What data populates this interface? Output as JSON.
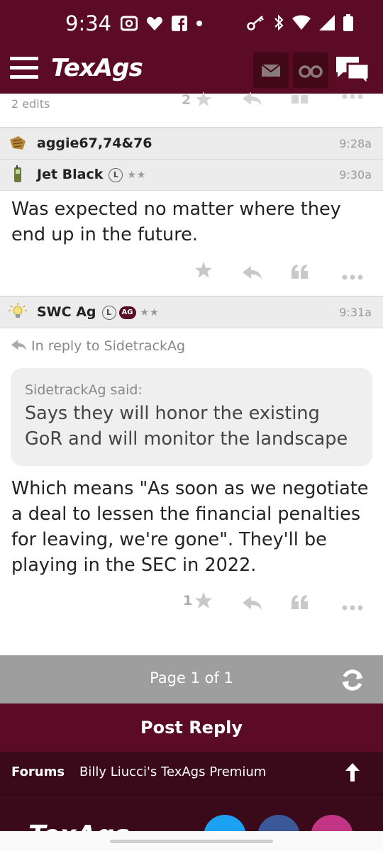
{
  "status_bar": {
    "time": "9:34"
  },
  "header": {
    "logo": "TexAgs",
    "icons": [
      "menu-icon",
      "mail-icon",
      "binoculars-icon",
      "chat-icon"
    ]
  },
  "previous_post": {
    "edits": "2 edits",
    "star_count": "2"
  },
  "posts": [
    {
      "username": "aggie67,74&76",
      "time": "9:28a",
      "avatar": "avatar-icon"
    },
    {
      "username": "Jet Black",
      "time": "9:30a",
      "badges": [
        "L"
      ],
      "stars": "★★",
      "body": "Was expected no matter where they end up in the future."
    },
    {
      "username": "SWC Ag",
      "time": "9:31a",
      "badges": [
        "L",
        "AG"
      ],
      "stars": "★★",
      "in_reply_to": "In reply to SidetrackAg",
      "quote": {
        "author": "SidetrackAg said:",
        "text": "Says they will honor the existing GoR and will monitor the landscape"
      },
      "body": "Which means \"As soon as we negotiate a deal to lessen the financial penalties for leaving, we're gone\". They'll be playing in the SEC in 2022.",
      "star_count": "1"
    }
  ],
  "pagination": {
    "label": "Page 1 of 1"
  },
  "post_reply": "Post Reply",
  "breadcrumb": {
    "forums": "Forums",
    "board": "Billy Liucci's TexAgs Premium"
  },
  "footer": {
    "logo": "TexAgs"
  },
  "colors": {
    "maroon": "#5c0b26",
    "dark_maroon": "#3b0a1a",
    "page_bar": "#9e9e9e",
    "twitter": "#1da1f2",
    "facebook": "#3b5998",
    "instagram": "#c13584"
  }
}
